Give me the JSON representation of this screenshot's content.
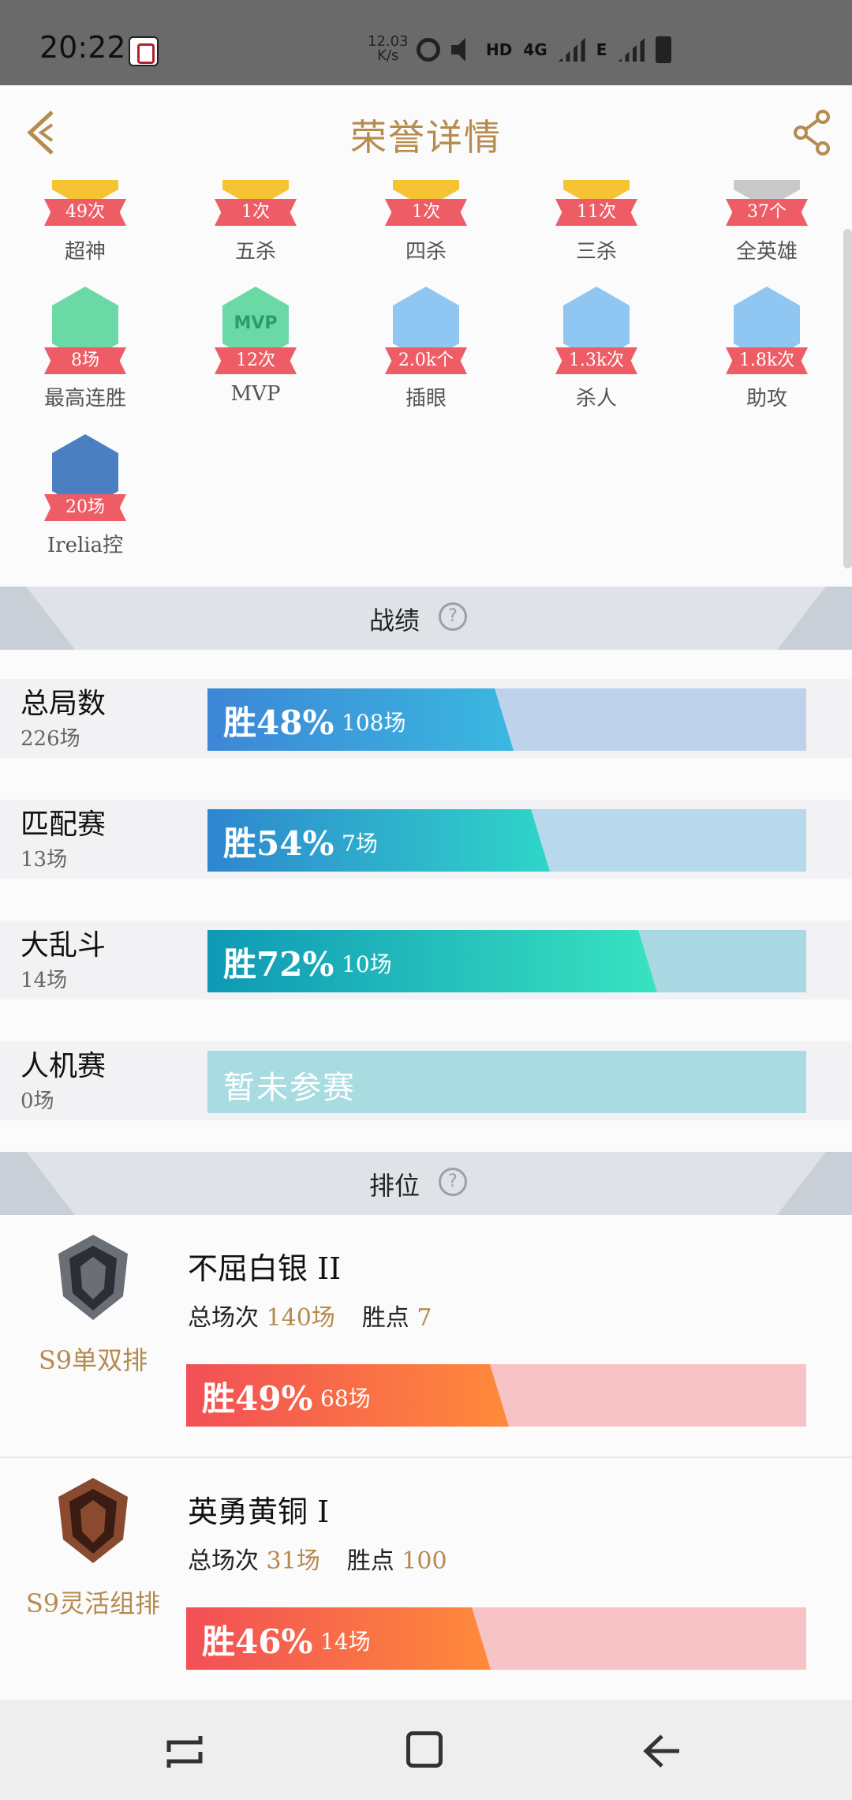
{
  "status": {
    "time": "20:22",
    "speed_top": "12.03",
    "speed_bottom": "K/s",
    "hd": "HD",
    "net": "4G",
    "e": "E"
  },
  "header": {
    "title": "荣誉详情"
  },
  "honors": [
    {
      "count": "49次",
      "label": "超神",
      "color": "#f6c333"
    },
    {
      "count": "1次",
      "label": "五杀",
      "color": "#f6c333"
    },
    {
      "count": "1次",
      "label": "四杀",
      "color": "#f6c333"
    },
    {
      "count": "11次",
      "label": "三杀",
      "color": "#f6c333"
    },
    {
      "count": "37个",
      "label": "全英雄",
      "color": "#c9c9c9"
    },
    {
      "count": "8场",
      "label": "最高连胜",
      "color": "#6bd9a6"
    },
    {
      "count": "12次",
      "label": "MVP",
      "color": "#6bd9a6",
      "inner": "MVP"
    },
    {
      "count": "2.0k个",
      "label": "插眼",
      "color": "#8fc6f2"
    },
    {
      "count": "1.3k次",
      "label": "杀人",
      "color": "#8fc6f2"
    },
    {
      "count": "1.8k次",
      "label": "助攻",
      "color": "#8fc6f2"
    },
    {
      "count": "20场",
      "label": "Irelia控",
      "color": "#4a7fc1"
    }
  ],
  "records_section": {
    "title": "战绩",
    "help": "?"
  },
  "records": [
    {
      "name": "总局数",
      "count": "226场",
      "pct": "胜48%",
      "games": "108场",
      "win_rate": 48,
      "bg": "#bfd2ec",
      "grad": [
        "#3d86d6",
        "#3ab8e0"
      ]
    },
    {
      "name": "匹配赛",
      "count": "13场",
      "pct": "胜54%",
      "games": "7场",
      "win_rate": 54,
      "bg": "#b8d8ec",
      "grad": [
        "#2e86d0",
        "#2ed6c8"
      ]
    },
    {
      "name": "大乱斗",
      "count": "14场",
      "pct": "胜72%",
      "games": "10场",
      "win_rate": 72,
      "bg": "#a9d8e2",
      "grad": [
        "#0f98b6",
        "#38e3c0"
      ]
    },
    {
      "name": "人机赛",
      "count": "0场",
      "none": "暂未参赛",
      "bg": "#a9dce0"
    }
  ],
  "rank_section": {
    "title": "排位",
    "help": "?"
  },
  "ranks": [
    {
      "tier": "不屈白银 II",
      "queue": "S9单双排",
      "total_label": "总场次",
      "total": "140场",
      "lp_label": "胜点",
      "lp": "7",
      "pct": "胜49%",
      "games": "68场",
      "win_rate": 49
    },
    {
      "tier": "英勇黄铜 I",
      "queue": "S9灵活组排",
      "total_label": "总场次",
      "total": "31场",
      "lp_label": "胜点",
      "lp": "100",
      "pct": "胜46%",
      "games": "14场",
      "win_rate": 46
    }
  ]
}
